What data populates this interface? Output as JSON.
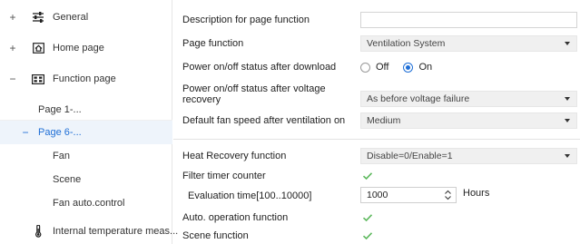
{
  "sidebar": {
    "items": [
      {
        "expander": "+",
        "icon": "sliders-icon",
        "label": "General"
      },
      {
        "expander": "+",
        "icon": "home-icon",
        "label": "Home page"
      },
      {
        "expander": "−",
        "icon": "grid-icon",
        "label": "Function page"
      },
      {
        "label": "Page 1-..."
      },
      {
        "expander": "−",
        "label": "Page 6-..."
      },
      {
        "label": "Fan"
      },
      {
        "label": "Scene"
      },
      {
        "label": "Fan auto.control"
      },
      {
        "icon": "thermometer-icon",
        "label": "Internal temperature meas..."
      }
    ]
  },
  "params": {
    "description": {
      "label": "Description for page function",
      "value": ""
    },
    "page_function": {
      "label": "Page function",
      "value": "Ventilation System"
    },
    "power_after_download": {
      "label": "Power on/off status after download",
      "options": [
        "Off",
        "On"
      ],
      "selected": "On"
    },
    "power_after_voltage": {
      "label": "Power on/off status after voltage recovery",
      "value": "As before voltage failure"
    },
    "default_fan_speed": {
      "label": "Default fan speed after ventilation on",
      "value": "Medium"
    },
    "heat_recovery": {
      "label": "Heat Recovery function",
      "value": "Disable=0/Enable=1"
    },
    "filter_timer": {
      "label": "Filter timer counter",
      "checked": true
    },
    "evaluation_time": {
      "label": "Evaluation time[100..10000]",
      "value": "1000",
      "unit": "Hours"
    },
    "auto_operation": {
      "label": "Auto. operation function",
      "checked": true
    },
    "scene_function": {
      "label": "Scene function",
      "checked": true
    }
  },
  "colors": {
    "accent": "#1e6ed6",
    "check": "#5cb85c",
    "active_bg": "#eef4fb"
  }
}
